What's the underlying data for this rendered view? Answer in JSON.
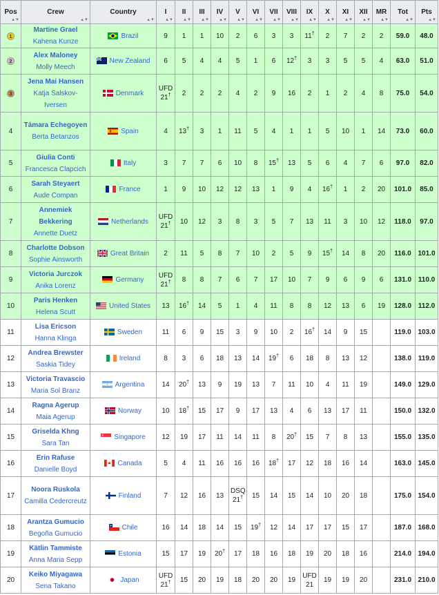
{
  "headers": {
    "pos": "Pos",
    "crew": "Crew",
    "country": "Country",
    "races": [
      "I",
      "II",
      "III",
      "IV",
      "V",
      "VI",
      "VII",
      "VIII",
      "IX",
      "X",
      "XI",
      "XII",
      "MR"
    ],
    "tot": "Tot",
    "pts": "Pts"
  },
  "rows": [
    {
      "pos": "1",
      "medal": "gold",
      "helm": "Martine Grael",
      "crew": "Kahena Kunze",
      "country": "Brazil",
      "flag": "brazil",
      "races": [
        [
          "9",
          ""
        ],
        [
          "1",
          ""
        ],
        [
          "1",
          ""
        ],
        [
          "10",
          ""
        ],
        [
          "2",
          ""
        ],
        [
          "6",
          ""
        ],
        [
          "3",
          ""
        ],
        [
          "3",
          ""
        ],
        [
          "11",
          "†"
        ],
        [
          "2",
          ""
        ],
        [
          "7",
          ""
        ],
        [
          "2",
          ""
        ],
        [
          "2",
          ""
        ]
      ],
      "tot": "59.0",
      "pts": "48.0"
    },
    {
      "pos": "2",
      "medal": "silver",
      "helm": "Alex Maloney",
      "crew": "Molly Meech",
      "country": "New Zealand",
      "flag": "newzealand",
      "races": [
        [
          "6",
          ""
        ],
        [
          "5",
          ""
        ],
        [
          "4",
          ""
        ],
        [
          "4",
          ""
        ],
        [
          "5",
          ""
        ],
        [
          "1",
          ""
        ],
        [
          "6",
          ""
        ],
        [
          "12",
          "†"
        ],
        [
          "3",
          ""
        ],
        [
          "3",
          ""
        ],
        [
          "5",
          ""
        ],
        [
          "5",
          ""
        ],
        [
          "4",
          ""
        ]
      ],
      "tot": "63.0",
      "pts": "51.0"
    },
    {
      "pos": "3",
      "medal": "bronze",
      "helm": "Jena Mai Hansen",
      "crew": "Katja Salskov-Iversen",
      "country": "Denmark",
      "flag": "denmark",
      "races": [
        [
          "UFD 21",
          "†"
        ],
        [
          "2",
          ""
        ],
        [
          "2",
          ""
        ],
        [
          "2",
          ""
        ],
        [
          "4",
          ""
        ],
        [
          "2",
          ""
        ],
        [
          "9",
          ""
        ],
        [
          "16",
          ""
        ],
        [
          "2",
          ""
        ],
        [
          "1",
          ""
        ],
        [
          "2",
          ""
        ],
        [
          "4",
          ""
        ],
        [
          "8",
          ""
        ]
      ],
      "tot": "75.0",
      "pts": "54.0"
    },
    {
      "pos": "4",
      "medal": "",
      "helm": "Támara Echegoyen",
      "crew": "Berta Betanzos",
      "country": "Spain",
      "flag": "spain",
      "races": [
        [
          "4",
          ""
        ],
        [
          "13",
          "†"
        ],
        [
          "3",
          ""
        ],
        [
          "1",
          ""
        ],
        [
          "11",
          ""
        ],
        [
          "5",
          ""
        ],
        [
          "4",
          ""
        ],
        [
          "1",
          ""
        ],
        [
          "1",
          ""
        ],
        [
          "5",
          ""
        ],
        [
          "10",
          ""
        ],
        [
          "1",
          ""
        ],
        [
          "14",
          ""
        ]
      ],
      "tot": "73.0",
      "pts": "60.0"
    },
    {
      "pos": "5",
      "medal": "",
      "helm": "Giulia Conti",
      "crew": "Francesca Clapcich",
      "country": "Italy",
      "flag": "italy",
      "races": [
        [
          "3",
          ""
        ],
        [
          "7",
          ""
        ],
        [
          "7",
          ""
        ],
        [
          "6",
          ""
        ],
        [
          "10",
          ""
        ],
        [
          "8",
          ""
        ],
        [
          "15",
          "†"
        ],
        [
          "13",
          ""
        ],
        [
          "5",
          ""
        ],
        [
          "6",
          ""
        ],
        [
          "4",
          ""
        ],
        [
          "7",
          ""
        ],
        [
          "6",
          ""
        ]
      ],
      "tot": "97.0",
      "pts": "82.0"
    },
    {
      "pos": "6",
      "medal": "",
      "helm": "Sarah Steyaert",
      "crew": "Aude Compan",
      "country": "France",
      "flag": "france",
      "races": [
        [
          "1",
          ""
        ],
        [
          "9",
          ""
        ],
        [
          "10",
          ""
        ],
        [
          "12",
          ""
        ],
        [
          "12",
          ""
        ],
        [
          "13",
          ""
        ],
        [
          "1",
          ""
        ],
        [
          "9",
          ""
        ],
        [
          "4",
          ""
        ],
        [
          "16",
          "†"
        ],
        [
          "1",
          ""
        ],
        [
          "2",
          ""
        ],
        [
          "20",
          ""
        ]
      ],
      "tot": "101.0",
      "pts": "85.0"
    },
    {
      "pos": "7",
      "medal": "",
      "helm": "Annemiek Bekkering",
      "crew": "Annette Duetz",
      "country": "Netherlands",
      "flag": "netherlands",
      "races": [
        [
          "UFD 21",
          "†"
        ],
        [
          "10",
          ""
        ],
        [
          "12",
          ""
        ],
        [
          "3",
          ""
        ],
        [
          "8",
          ""
        ],
        [
          "3",
          ""
        ],
        [
          "5",
          ""
        ],
        [
          "7",
          ""
        ],
        [
          "13",
          ""
        ],
        [
          "11",
          ""
        ],
        [
          "3",
          ""
        ],
        [
          "10",
          ""
        ],
        [
          "12",
          ""
        ]
      ],
      "tot": "118.0",
      "pts": "97.0"
    },
    {
      "pos": "8",
      "medal": "",
      "helm": "Charlotte Dobson",
      "crew": "Sophie Ainsworth",
      "country": "Great Britain",
      "flag": "uk",
      "races": [
        [
          "2",
          ""
        ],
        [
          "11",
          ""
        ],
        [
          "5",
          ""
        ],
        [
          "8",
          ""
        ],
        [
          "7",
          ""
        ],
        [
          "10",
          ""
        ],
        [
          "2",
          ""
        ],
        [
          "5",
          ""
        ],
        [
          "9",
          ""
        ],
        [
          "15",
          "†"
        ],
        [
          "14",
          ""
        ],
        [
          "8",
          ""
        ],
        [
          "20",
          ""
        ]
      ],
      "tot": "116.0",
      "pts": "101.0"
    },
    {
      "pos": "9",
      "medal": "",
      "helm": "Victoria Jurczok",
      "crew": "Anika Lorenz",
      "country": "Germany",
      "flag": "germany",
      "races": [
        [
          "UFD 21",
          "†"
        ],
        [
          "8",
          ""
        ],
        [
          "8",
          ""
        ],
        [
          "7",
          ""
        ],
        [
          "6",
          ""
        ],
        [
          "7",
          ""
        ],
        [
          "17",
          ""
        ],
        [
          "10",
          ""
        ],
        [
          "7",
          ""
        ],
        [
          "9",
          ""
        ],
        [
          "6",
          ""
        ],
        [
          "9",
          ""
        ],
        [
          "6",
          ""
        ]
      ],
      "tot": "131.0",
      "pts": "110.0"
    },
    {
      "pos": "10",
      "medal": "",
      "helm": "Paris Henken",
      "crew": "Helena Scutt",
      "country": "United States",
      "flag": "usa",
      "races": [
        [
          "13",
          ""
        ],
        [
          "16",
          "†"
        ],
        [
          "14",
          ""
        ],
        [
          "5",
          ""
        ],
        [
          "1",
          ""
        ],
        [
          "4",
          ""
        ],
        [
          "11",
          ""
        ],
        [
          "8",
          ""
        ],
        [
          "8",
          ""
        ],
        [
          "12",
          ""
        ],
        [
          "13",
          ""
        ],
        [
          "6",
          ""
        ],
        [
          "19",
          ""
        ]
      ],
      "tot": "128.0",
      "pts": "112.0"
    },
    {
      "pos": "11",
      "medal": "",
      "helm": "Lisa Ericson",
      "crew": "Hanna Klinga",
      "country": "Sweden",
      "flag": "sweden",
      "races": [
        [
          "11",
          ""
        ],
        [
          "6",
          ""
        ],
        [
          "9",
          ""
        ],
        [
          "15",
          ""
        ],
        [
          "3",
          ""
        ],
        [
          "9",
          ""
        ],
        [
          "10",
          ""
        ],
        [
          "2",
          ""
        ],
        [
          "16",
          "†"
        ],
        [
          "14",
          ""
        ],
        [
          "9",
          ""
        ],
        [
          "15",
          ""
        ],
        [
          "",
          ""
        ]
      ],
      "tot": "119.0",
      "pts": "103.0"
    },
    {
      "pos": "12",
      "medal": "",
      "helm": "Andrea Brewster",
      "crew": "Saskia Tidey",
      "country": "Ireland",
      "flag": "ireland",
      "races": [
        [
          "8",
          ""
        ],
        [
          "3",
          ""
        ],
        [
          "6",
          ""
        ],
        [
          "18",
          ""
        ],
        [
          "13",
          ""
        ],
        [
          "14",
          ""
        ],
        [
          "19",
          "†"
        ],
        [
          "6",
          ""
        ],
        [
          "18",
          ""
        ],
        [
          "8",
          ""
        ],
        [
          "13",
          ""
        ],
        [
          "12",
          ""
        ],
        [
          "",
          ""
        ]
      ],
      "tot": "138.0",
      "pts": "119.0"
    },
    {
      "pos": "13",
      "medal": "",
      "helm": "Victoria Travascio",
      "crew": "Maria Sol Branz",
      "country": "Argentina",
      "flag": "argentina",
      "races": [
        [
          "14",
          ""
        ],
        [
          "20",
          "†"
        ],
        [
          "13",
          ""
        ],
        [
          "9",
          ""
        ],
        [
          "19",
          ""
        ],
        [
          "13",
          ""
        ],
        [
          "7",
          ""
        ],
        [
          "11",
          ""
        ],
        [
          "10",
          ""
        ],
        [
          "4",
          ""
        ],
        [
          "11",
          ""
        ],
        [
          "19",
          ""
        ],
        [
          "",
          ""
        ]
      ],
      "tot": "149.0",
      "pts": "129.0"
    },
    {
      "pos": "14",
      "medal": "",
      "helm": "Ragna Agerup",
      "crew": "Maia Agerup",
      "country": "Norway",
      "flag": "norway",
      "races": [
        [
          "10",
          ""
        ],
        [
          "18",
          "†"
        ],
        [
          "15",
          ""
        ],
        [
          "17",
          ""
        ],
        [
          "9",
          ""
        ],
        [
          "17",
          ""
        ],
        [
          "13",
          ""
        ],
        [
          "4",
          ""
        ],
        [
          "6",
          ""
        ],
        [
          "13",
          ""
        ],
        [
          "17",
          ""
        ],
        [
          "11",
          ""
        ],
        [
          "",
          ""
        ]
      ],
      "tot": "150.0",
      "pts": "132.0"
    },
    {
      "pos": "15",
      "medal": "",
      "helm": "Griselda Khng",
      "crew": "Sara Tan",
      "country": "Singapore",
      "flag": "singapore",
      "races": [
        [
          "12",
          ""
        ],
        [
          "19",
          ""
        ],
        [
          "17",
          ""
        ],
        [
          "11",
          ""
        ],
        [
          "14",
          ""
        ],
        [
          "11",
          ""
        ],
        [
          "8",
          ""
        ],
        [
          "20",
          "†"
        ],
        [
          "15",
          ""
        ],
        [
          "7",
          ""
        ],
        [
          "8",
          ""
        ],
        [
          "13",
          ""
        ],
        [
          "",
          ""
        ]
      ],
      "tot": "155.0",
      "pts": "135.0"
    },
    {
      "pos": "16",
      "medal": "",
      "helm": "Erin Rafuse",
      "crew": "Danielle Boyd",
      "country": "Canada",
      "flag": "canada",
      "races": [
        [
          "5",
          ""
        ],
        [
          "4",
          ""
        ],
        [
          "11",
          ""
        ],
        [
          "16",
          ""
        ],
        [
          "16",
          ""
        ],
        [
          "16",
          ""
        ],
        [
          "18",
          "†"
        ],
        [
          "17",
          ""
        ],
        [
          "12",
          ""
        ],
        [
          "18",
          ""
        ],
        [
          "16",
          ""
        ],
        [
          "14",
          ""
        ],
        [
          "",
          ""
        ]
      ],
      "tot": "163.0",
      "pts": "145.0"
    },
    {
      "pos": "17",
      "medal": "",
      "helm": "Noora Ruskola",
      "crew": "Camilla Cedercreutz",
      "country": "Finland",
      "flag": "finland",
      "races": [
        [
          "7",
          ""
        ],
        [
          "12",
          ""
        ],
        [
          "16",
          ""
        ],
        [
          "13",
          ""
        ],
        [
          "DSQ 21",
          "†"
        ],
        [
          "15",
          ""
        ],
        [
          "14",
          ""
        ],
        [
          "15",
          ""
        ],
        [
          "14",
          ""
        ],
        [
          "10",
          ""
        ],
        [
          "20",
          ""
        ],
        [
          "18",
          ""
        ],
        [
          "",
          ""
        ]
      ],
      "tot": "175.0",
      "pts": "154.0"
    },
    {
      "pos": "18",
      "medal": "",
      "helm": "Arantza Gumucio",
      "crew": "Begoña Gumucio",
      "country": "Chile",
      "flag": "chile",
      "races": [
        [
          "16",
          ""
        ],
        [
          "14",
          ""
        ],
        [
          "18",
          ""
        ],
        [
          "14",
          ""
        ],
        [
          "15",
          ""
        ],
        [
          "19",
          "†"
        ],
        [
          "12",
          ""
        ],
        [
          "14",
          ""
        ],
        [
          "17",
          ""
        ],
        [
          "17",
          ""
        ],
        [
          "15",
          ""
        ],
        [
          "17",
          ""
        ],
        [
          "",
          ""
        ]
      ],
      "tot": "187.0",
      "pts": "168.0"
    },
    {
      "pos": "19",
      "medal": "",
      "helm": "Kätlin Tammiste",
      "crew": "Anna Maria Sepp",
      "country": "Estonia",
      "flag": "estonia",
      "races": [
        [
          "15",
          ""
        ],
        [
          "17",
          ""
        ],
        [
          "19",
          ""
        ],
        [
          "20",
          "†"
        ],
        [
          "17",
          ""
        ],
        [
          "18",
          ""
        ],
        [
          "16",
          ""
        ],
        [
          "18",
          ""
        ],
        [
          "19",
          ""
        ],
        [
          "20",
          ""
        ],
        [
          "18",
          ""
        ],
        [
          "16",
          ""
        ],
        [
          "",
          ""
        ]
      ],
      "tot": "214.0",
      "pts": "194.0"
    },
    {
      "pos": "20",
      "medal": "",
      "helm": "Keiko Miyagawa",
      "crew": "Sena Takano",
      "country": "Japan",
      "flag": "japan",
      "races": [
        [
          "UFD 21",
          "†"
        ],
        [
          "15",
          ""
        ],
        [
          "20",
          ""
        ],
        [
          "19",
          ""
        ],
        [
          "18",
          ""
        ],
        [
          "20",
          ""
        ],
        [
          "20",
          ""
        ],
        [
          "19",
          ""
        ],
        [
          "UFD 21",
          ""
        ],
        [
          "19",
          ""
        ],
        [
          "19",
          ""
        ],
        [
          "20",
          ""
        ],
        [
          "",
          ""
        ]
      ],
      "tot": "231.0",
      "pts": "210.0"
    }
  ]
}
